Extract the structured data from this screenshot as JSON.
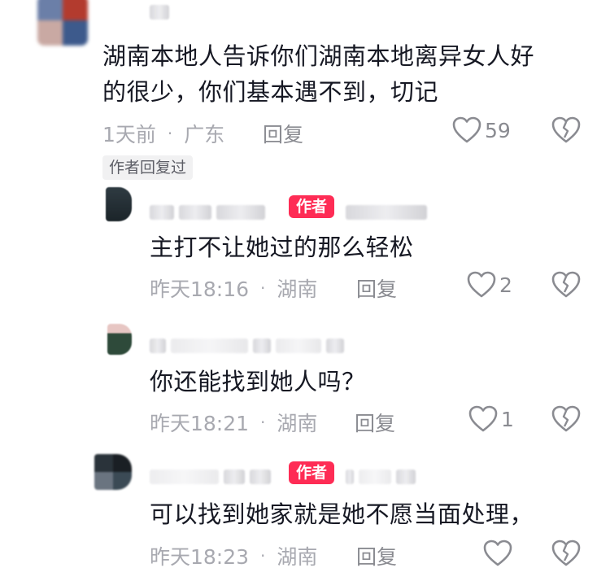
{
  "comments": [
    {
      "text_lines": [
        "湖南本地人告诉你们湖南本地离异女人好",
        "的很少，你们基本遇不到，切记"
      ],
      "time": "1天前",
      "location": "广东",
      "reply_label": "回复",
      "likes": "59",
      "tag": "作者回复过"
    },
    {
      "author_badge": "作者",
      "text_lines": [
        "主打不让她过的那么轻松"
      ],
      "time": "昨天18:16",
      "location": "湖南",
      "reply_label": "回复",
      "likes": "2"
    },
    {
      "text_lines": [
        "你还能找到她人吗？"
      ],
      "time": "昨天18:21",
      "location": "湖南",
      "reply_label": "回复",
      "likes": "1"
    },
    {
      "author_badge": "作者",
      "text_lines": [
        "可以找到她家就是她不愿当面处理，"
      ],
      "time": "昨天18:23",
      "location": "湖南",
      "reply_label": "回复",
      "likes": ""
    }
  ],
  "separator": "·",
  "colors": {
    "author_badge": "#fe2c55",
    "meta": "#a8a9b0",
    "text": "#161823"
  },
  "icons": {
    "like": "heart-outline-icon",
    "dislike": "broken-heart-icon"
  }
}
